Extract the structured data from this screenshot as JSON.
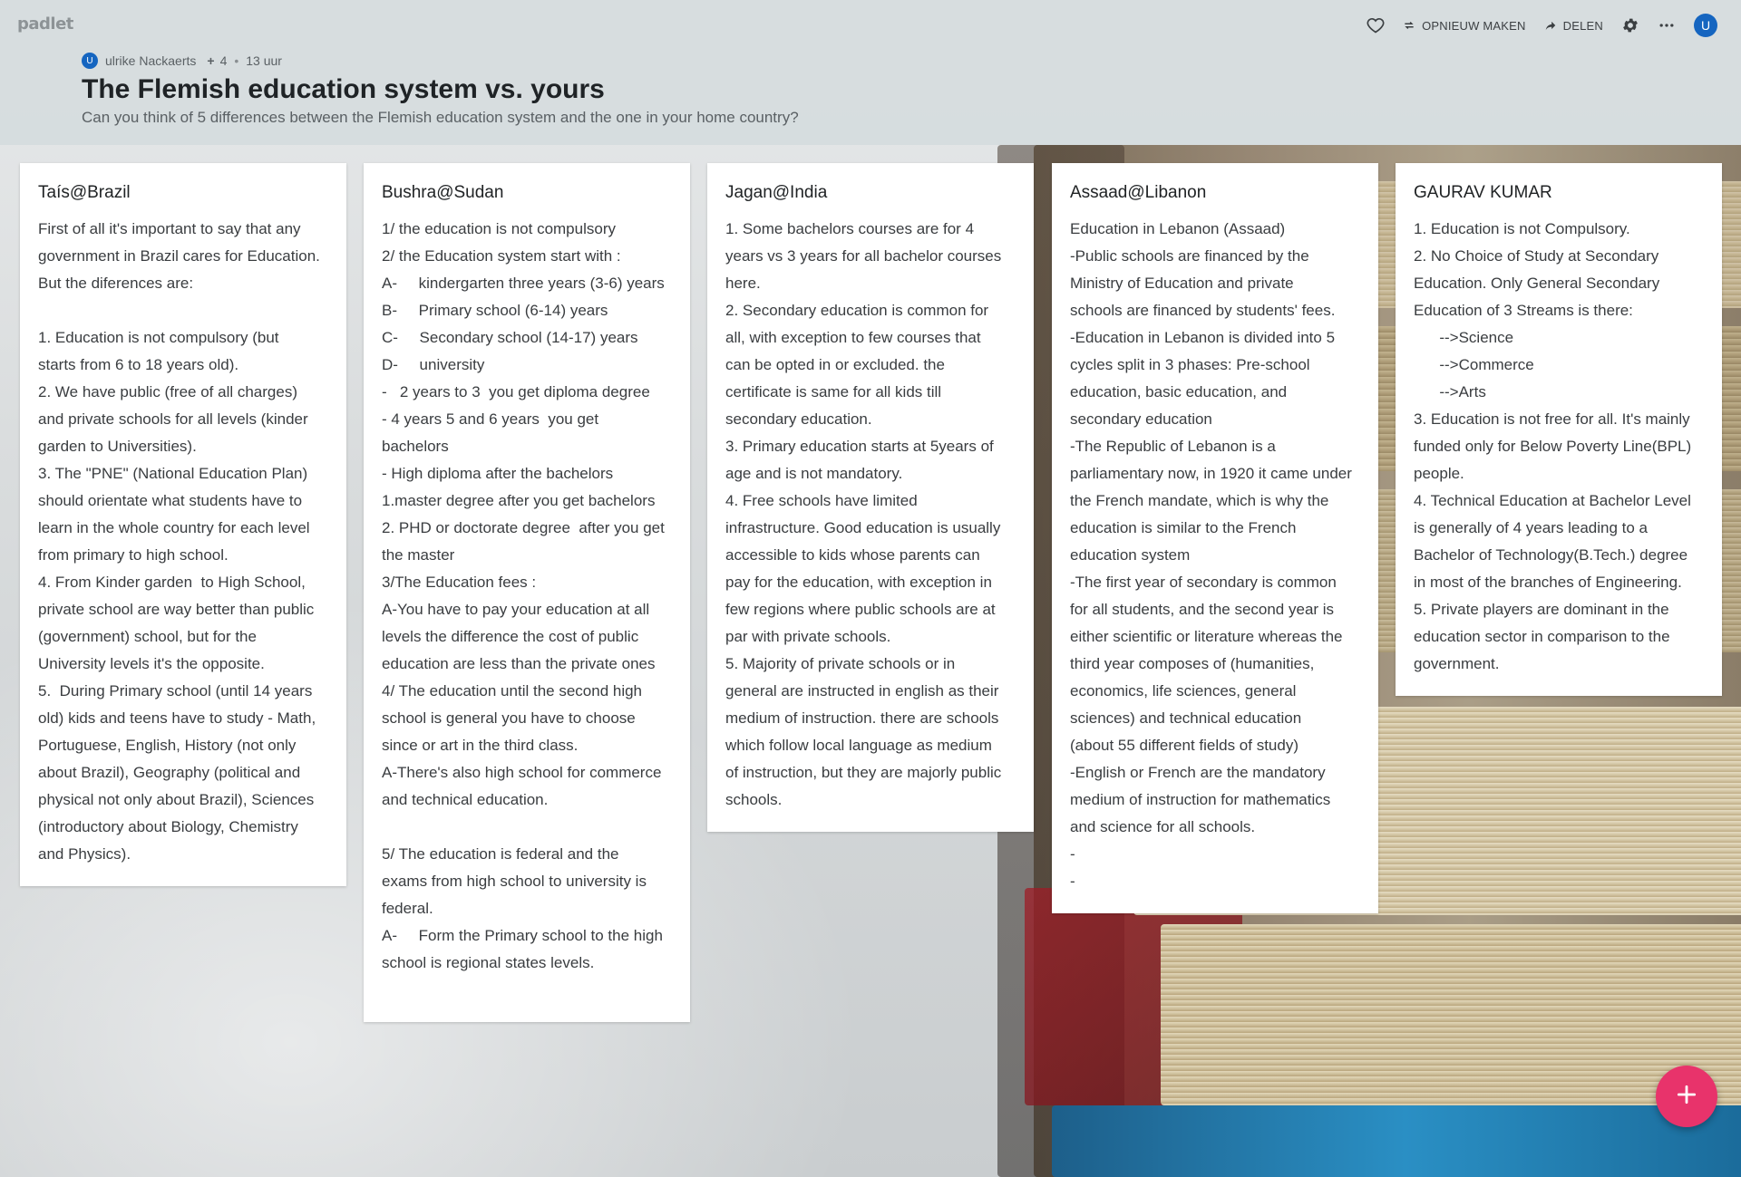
{
  "app": {
    "logo": "padlet"
  },
  "toolbar": {
    "remake_label": "OPNIEUW MAKEN",
    "share_label": "DELEN",
    "avatar_initial": "U"
  },
  "header": {
    "author_initial": "U",
    "author": "ulrike Nackaerts",
    "contributors": "4",
    "time": "13 uur",
    "title": "The Flemish education system vs. yours",
    "subtitle": "Can you think of 5 differences between the Flemish education system and the one in your home country?"
  },
  "posts": [
    {
      "title": "Taís@Brazil",
      "lines": [
        "First of all it's important to say that any",
        "government in Brazil cares for Education.",
        "But the diferences are:",
        "",
        "1. Education is not compulsory (but",
        "starts from 6 to 18 years old).",
        "2. We have public (free of all charges)",
        "and private schools for all levels (kinder",
        "garden to Universities).",
        "3. The \"PNE\" (National Education Plan)",
        "should orientate what students have to",
        "learn in the whole country for each level",
        "from primary to high school.",
        "4. From Kinder garden  to High School,",
        "private school are way better than public",
        "(government) school, but for the",
        "University levels it's the opposite.",
        "5.  During Primary school (until 14 years",
        "old) kids and teens have to study - Math,",
        "Portuguese, English, History (not only",
        "about Brazil), Geography (political and",
        "physical not only about Brazil), Sciences",
        "(introductory about Biology, Chemistry",
        "and Physics)."
      ]
    },
    {
      "title": "Bushra@Sudan",
      "lines": [
        "1/ the education is not compulsory",
        "2/ the Education system start with :",
        "A-     kindergarten three years (3-6) years",
        "B-     Primary school (6-14) years",
        "C-     Secondary school (14-17) years",
        "D-     university",
        "-   2 years to 3  you get diploma degree",
        "- 4 years 5 and 6 years  you get",
        "bachelors",
        "- High diploma after the bachelors",
        "1.master degree after you get bachelors",
        "2. PHD or doctorate degree  after you get",
        "the master",
        "3/The Education fees :",
        "A-You have to pay your education at all",
        "levels the difference the cost of public",
        "education are less than the private ones",
        "4/ The education until the second high",
        "school is general you have to choose",
        "since or art in the third class.",
        "A-There's also high school for commerce",
        "and technical education.",
        "",
        "5/ The education is federal and the",
        "exams from high school to university is",
        "federal.",
        "A-     Form the Primary school to the high",
        "school is regional states levels.",
        ""
      ]
    },
    {
      "title": "Jagan@India",
      "lines": [
        "1. Some bachelors courses are for 4",
        "years vs 3 years for all bachelor courses",
        "here.",
        "2. Secondary education is common for",
        "all, with exception to few courses that",
        "can be opted in or excluded. the",
        "certificate is same for all kids till",
        "secondary education.",
        "3. Primary education starts at 5years of",
        "age and is not mandatory.",
        "4. Free schools have limited",
        "infrastructure. Good education is usually",
        "accessible to kids whose parents can",
        "pay for the education, with exception in",
        "few regions where public schools are at",
        "par with private schools.",
        "5. Majority of private schools or in",
        "general are instructed in english as their",
        "medium of instruction. there are schools",
        "which follow local language as medium",
        "of instruction, but they are majorly public",
        "schools."
      ]
    },
    {
      "title": "Assaad@Libanon",
      "lines": [
        "Education in Lebanon (Assaad)",
        "-Public schools are financed by the",
        "Ministry of Education and private",
        "schools are financed by students' fees.",
        "-Education in Lebanon is divided into 5",
        "cycles split in 3 phases: Pre-school",
        "education, basic education, and",
        "secondary education",
        "-The Republic of Lebanon is a",
        "parliamentary now, in 1920 it came under",
        "the French mandate, which is why the",
        "education is similar to the French",
        "education system",
        "-The first year of secondary is common",
        "for all students, and the second year is",
        "either scientific or literature whereas the",
        "third year composes of (humanities,",
        "economics, life sciences, general",
        "sciences) and technical education",
        "(about 55 different fields of study)",
        "-English or French are the mandatory",
        "medium of instruction for mathematics",
        "and science for all schools.",
        "-",
        "-"
      ]
    },
    {
      "title": "GAURAV KUMAR",
      "lines": [
        "1. Education is not Compulsory.",
        "2. No Choice of Study at Secondary",
        "Education. Only General Secondary",
        "Education of 3 Streams is there:",
        "      -->Science",
        "      -->Commerce",
        "      -->Arts",
        "3. Education is not free for all. It's mainly",
        "funded only for Below Poverty Line(BPL)",
        "people.",
        "4. Technical Education at Bachelor Level",
        "is generally of 4 years leading to a",
        "Bachelor of Technology(B.Tech.) degree",
        "in most of the branches of Engineering.",
        "5. Private players are dominant in the",
        "education sector in comparison to the",
        "government."
      ]
    }
  ],
  "colors": {
    "accent": "#e8336b",
    "avatar": "#1565c0"
  }
}
